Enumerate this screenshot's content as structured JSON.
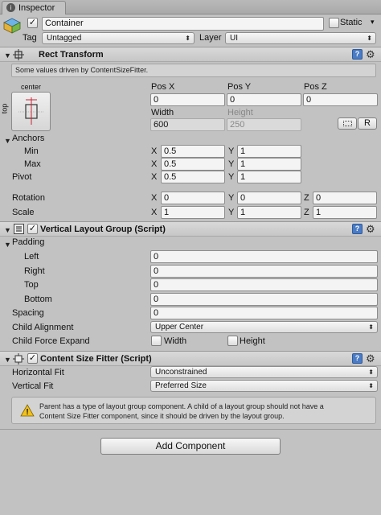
{
  "tab": {
    "title": "Inspector"
  },
  "gameobject": {
    "name": "Container",
    "static_label": "Static",
    "tag_label": "Tag",
    "tag_value": "Untagged",
    "layer_label": "Layer",
    "layer_value": "UI"
  },
  "rect_transform": {
    "title": "Rect Transform",
    "info": "Some values driven by ContentSizeFitter.",
    "anchor_preset_top": "center",
    "anchor_preset_side": "top",
    "col_pos_x": "Pos X",
    "col_pos_y": "Pos Y",
    "col_pos_z": "Pos Z",
    "pos_x": "0",
    "pos_y": "0",
    "pos_z": "0",
    "col_width": "Width",
    "col_height": "Height",
    "width": "600",
    "height": "250",
    "raw_button": "R",
    "anchors_label": "Anchors",
    "min_label": "Min",
    "max_label": "Max",
    "pivot_label": "Pivot",
    "min_x": "0.5",
    "min_y": "1",
    "max_x": "0.5",
    "max_y": "1",
    "pivot_x": "0.5",
    "pivot_y": "1",
    "rotation_label": "Rotation",
    "rot_x": "0",
    "rot_y": "0",
    "rot_z": "0",
    "scale_label": "Scale",
    "scale_x": "1",
    "scale_y": "1",
    "scale_z": "1",
    "x": "X",
    "y": "Y",
    "z": "Z"
  },
  "vertical_layout": {
    "title": "Vertical Layout Group (Script)",
    "padding_label": "Padding",
    "left_label": "Left",
    "left": "0",
    "right_label": "Right",
    "right": "0",
    "top_label": "Top",
    "top": "0",
    "bottom_label": "Bottom",
    "bottom": "0",
    "spacing_label": "Spacing",
    "spacing": "0",
    "child_alignment_label": "Child Alignment",
    "child_alignment": "Upper Center",
    "child_force_expand_label": "Child Force Expand",
    "width_label": "Width",
    "height_label": "Height"
  },
  "content_size_fitter": {
    "title": "Content Size Fitter (Script)",
    "horizontal_fit_label": "Horizontal Fit",
    "horizontal_fit": "Unconstrained",
    "vertical_fit_label": "Vertical Fit",
    "vertical_fit": "Preferred Size",
    "warning_line1": "Parent has a type of layout group component. A child of a layout group should not have a",
    "warning_line2": "Content Size Fitter component, since it should be driven by the layout group."
  },
  "add_component": {
    "label": "Add Component"
  },
  "glyphs": {
    "check": "✓",
    "arrow": "▾",
    "fold_open": "▼",
    "gear": "⚙",
    "help": "?",
    "warning": "!",
    "cube": "cube-icon",
    "fold_right": "▶"
  }
}
